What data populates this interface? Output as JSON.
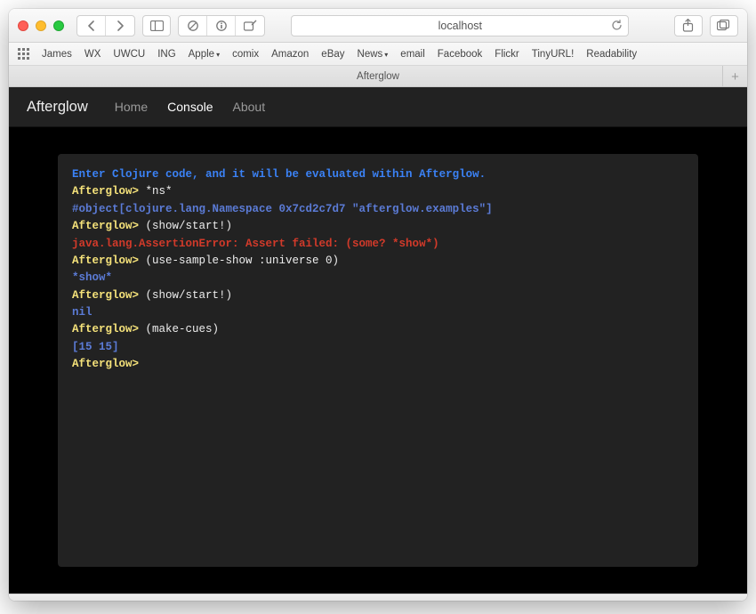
{
  "window": {
    "traffic": [
      "close",
      "minimize",
      "zoom"
    ]
  },
  "toolbar": {
    "back_label": "Back",
    "forward_label": "Forward",
    "sidebar_label": "Sidebar",
    "address": "localhost",
    "reload_label": "Reload",
    "share_label": "Share",
    "tabs_overview_label": "Tabs"
  },
  "bookmarks": {
    "items": [
      "James",
      "WX",
      "UWCU",
      "ING",
      "Apple",
      "comix",
      "Amazon",
      "eBay",
      "News",
      "email",
      "Facebook",
      "Flickr",
      "TinyURL!",
      "Readability"
    ],
    "dropdown_indices": [
      4,
      8
    ]
  },
  "tabstrip": {
    "active_tab": "Afterglow",
    "newtab_label": "+"
  },
  "app": {
    "brand": "Afterglow",
    "nav_items": [
      {
        "label": "Home",
        "active": false
      },
      {
        "label": "Console",
        "active": true
      },
      {
        "label": "About",
        "active": false
      }
    ]
  },
  "console": {
    "intro": "Enter Clojure code, and it will be evaluated within Afterglow.",
    "prompt": "Afterglow>",
    "entries": [
      {
        "input": "*ns*",
        "output": "#object[clojure.lang.Namespace 0x7cd2c7d7 \"afterglow.examples\"]",
        "kind": "result"
      },
      {
        "input": "(show/start!)",
        "output": "java.lang.AssertionError: Assert failed: (some? *show*)",
        "kind": "error"
      },
      {
        "input": "(use-sample-show :universe 0)",
        "output": "*show*",
        "kind": "result"
      },
      {
        "input": "(show/start!)",
        "output": "nil",
        "kind": "result"
      },
      {
        "input": "(make-cues)",
        "output": "[15 15]",
        "kind": "result"
      }
    ]
  }
}
